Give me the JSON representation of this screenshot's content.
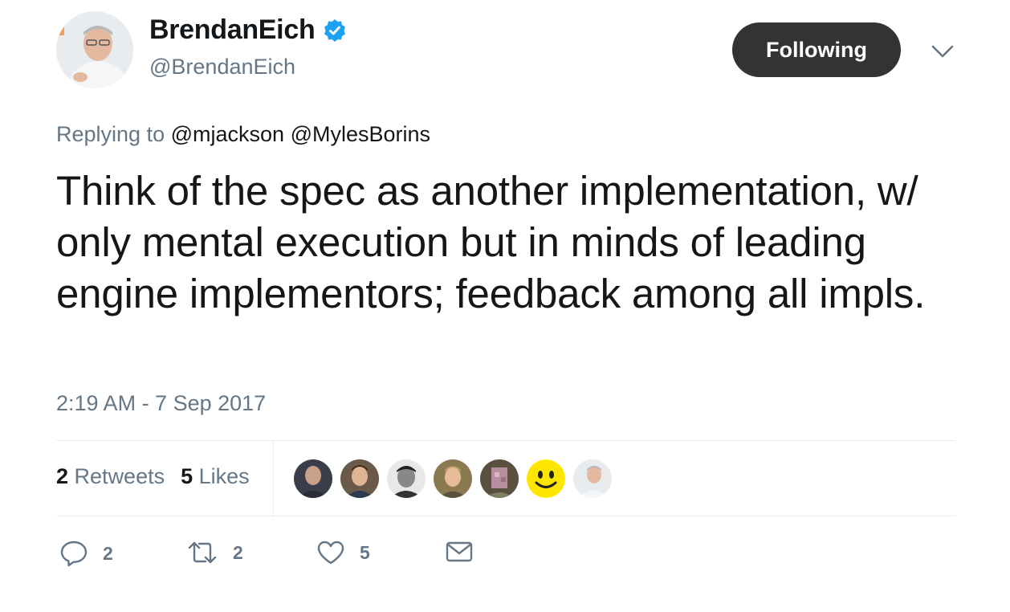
{
  "author": {
    "name": "BrendanEich",
    "handle": "@BrendanEich",
    "verified": true
  },
  "follow_button": {
    "label": "Following"
  },
  "reply_context": {
    "prefix": "Replying to",
    "mentions": [
      "@mjackson",
      "@MylesBorins"
    ]
  },
  "tweet": {
    "text": "Think of the spec as another implementation, w/ only mental execution but in minds of leading engine implementors; feedback among all impls.",
    "timestamp": "2:19 AM - 7 Sep 2017"
  },
  "stats": {
    "retweets_count": "2",
    "retweets_label": "Retweets",
    "likes_count": "5",
    "likes_label": "Likes"
  },
  "actions": {
    "reply_count": "2",
    "retweet_count": "2",
    "like_count": "5"
  },
  "colors": {
    "text": "#14171a",
    "secondary": "#657786",
    "verified": "#1da1f2",
    "button_bg": "#333333",
    "divider": "#e6ecf0"
  }
}
